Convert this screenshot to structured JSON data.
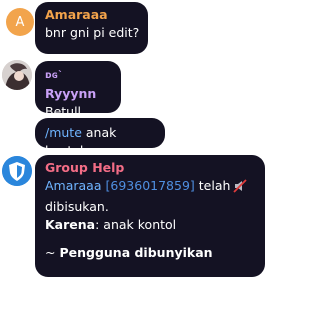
{
  "messages": [
    {
      "sender": "Amaraaa",
      "sender_color": "#f3a34b",
      "avatar_letter": "A",
      "text": "bnr gni pi edit?"
    },
    {
      "sender_prefix": "ᴅɢ`",
      "sender": "Ryyynn",
      "sender_color": "#c8a0f6",
      "text": "Betull"
    },
    {
      "command": "/mute",
      "text": "anak kontol"
    },
    {
      "sender": "Group Help",
      "sender_color": "#f36d86",
      "mention": "Amaraaa",
      "user_id": "[6936017859]",
      "line1_suffix": "telah",
      "emoji_icon": "muted-speaker-icon",
      "line2": "dibisukan.",
      "reason_label": "Karena",
      "reason_text": ": anak kontol",
      "footer_prefix": "~",
      "footer": "Pengguna dibunyikan"
    }
  ]
}
